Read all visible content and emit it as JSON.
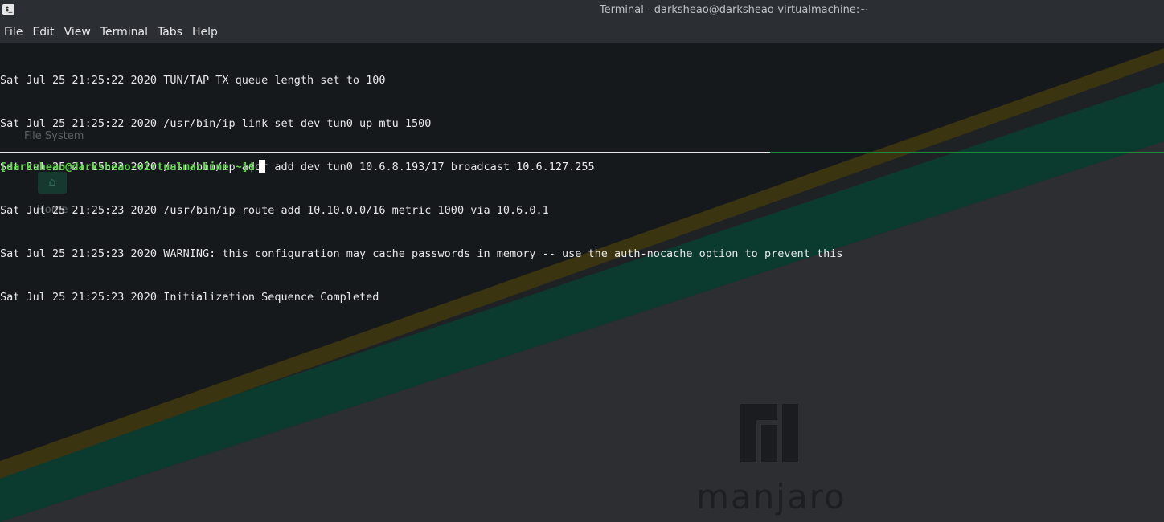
{
  "window": {
    "title": "Terminal - darksheao@darksheao-virtualmachine:~",
    "icon_label": "$_"
  },
  "menu": [
    "File",
    "Edit",
    "View",
    "Terminal",
    "Tabs",
    "Help"
  ],
  "terminal": {
    "output_lines": [
      "Sat Jul 25 21:25:22 2020 TUN/TAP TX queue length set to 100",
      "Sat Jul 25 21:25:22 2020 /usr/bin/ip link set dev tun0 up mtu 1500",
      "Sat Jul 25 21:25:23 2020 /usr/bin/ip addr add dev tun0 10.6.8.193/17 broadcast 10.6.127.255",
      "Sat Jul 25 21:25:23 2020 /usr/bin/ip route add 10.10.0.0/16 metric 1000 via 10.6.0.1",
      "Sat Jul 25 21:25:23 2020 WARNING: this configuration may cache passwords in memory -- use the auth-nocache option to prevent this",
      "Sat Jul 25 21:25:23 2020 Initialization Sequence Completed"
    ],
    "prompt": "[darksheao@darksheao-virtualmachine ~]$"
  },
  "desktop": {
    "icons": {
      "file_system_label": "File System",
      "home_label": "Home"
    },
    "wallpaper_brand": "manjaro",
    "colors": {
      "stripe_yellow": "#3a3410",
      "stripe_teal": "#0b3a2f",
      "prompt_green": "#5ed64a",
      "separator_green": "#1d8a3e"
    }
  }
}
